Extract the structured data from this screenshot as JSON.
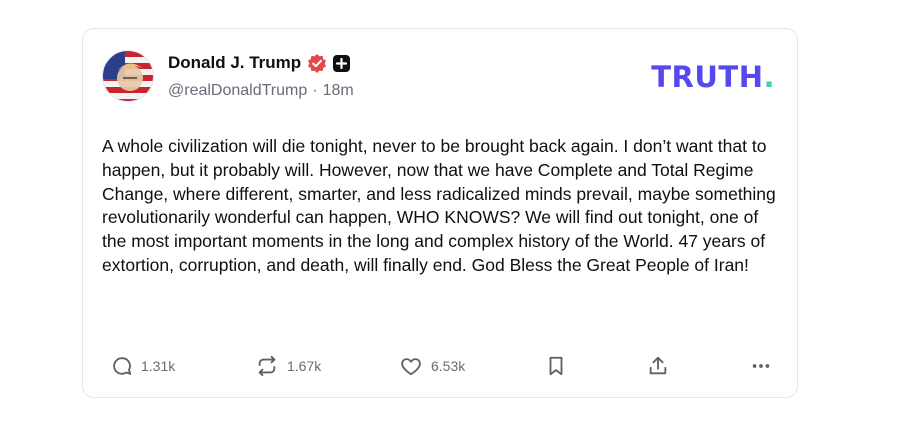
{
  "author": {
    "display_name": "Donald J. Trump",
    "handle": "@realDonaldTrump",
    "separator": "·",
    "time": "18m",
    "verified_icon": "verified-badge-icon",
    "plus_icon": "plus-badge-icon"
  },
  "brand": {
    "logo_text": "TRUTH",
    "logo_dot": ".",
    "color": "#5448ee",
    "dot_color": "#39d3a5"
  },
  "post": {
    "text": "A whole civilization will die tonight, never to be brought back again. I don’t want that to happen, but it probably will. However, now that we have Complete and Total Regime Change, where different, smarter, and less radicalized minds prevail, maybe something revolutionarily wonderful can happen, WHO KNOWS? We will find out tonight, one of the most important moments in the long and complex history of the World. 47 years of extortion, corruption, and death, will finally end. God Bless the Great People of Iran!"
  },
  "actions": {
    "replies": {
      "icon": "reply-icon",
      "count": "1.31k"
    },
    "retruths": {
      "icon": "retruth-icon",
      "count": "1.67k"
    },
    "likes": {
      "icon": "heart-icon",
      "count": "6.53k"
    },
    "bookmark": {
      "icon": "bookmark-icon"
    },
    "share": {
      "icon": "share-icon"
    },
    "more": {
      "icon": "more-icon"
    }
  }
}
